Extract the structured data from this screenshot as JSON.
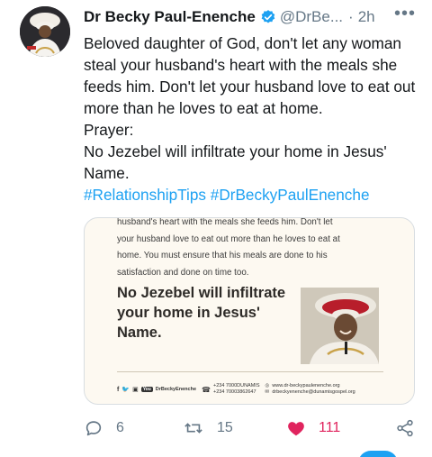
{
  "author": {
    "name": "Dr Becky Paul-Enenche",
    "handle": "@DrBe...",
    "separator": "·",
    "time": "2h",
    "more": "•••"
  },
  "tweet": {
    "lines": [
      "Beloved daughter of God, don't let any woman steal your husband's heart with the meals she feeds him. Don't let your husband love to eat out more than he loves to eat at home.",
      "Prayer:",
      "No Jezebel will infiltrate your home in Jesus' Name."
    ],
    "hashtags": "#RelationshipTips #DrBeckyPaulEnenche"
  },
  "card": {
    "body_lines": [
      "husband's heart with the meals she feeds him. Don't let",
      "your husband love to eat out more than he loves to eat at",
      "home. You must ensure that his meals are done to his",
      "satisfaction and done on time too."
    ],
    "title": "No Jezebel will infiltrate your home in Jesus' Name.",
    "footer": {
      "social_label": "DrBeckyEnenche",
      "phone_1": "+234 7000DUNAMIS",
      "phone_2": "+234 70003862647",
      "website": "www.dr-beckypaulenenche.org",
      "email": "drbeckyenenche@dunamisgospel.org"
    }
  },
  "actions": {
    "reply_count": "6",
    "retweet_count": "15",
    "like_count": "111"
  },
  "colors": {
    "link": "#1da1f2",
    "like": "#e0245e",
    "muted": "#657786"
  }
}
